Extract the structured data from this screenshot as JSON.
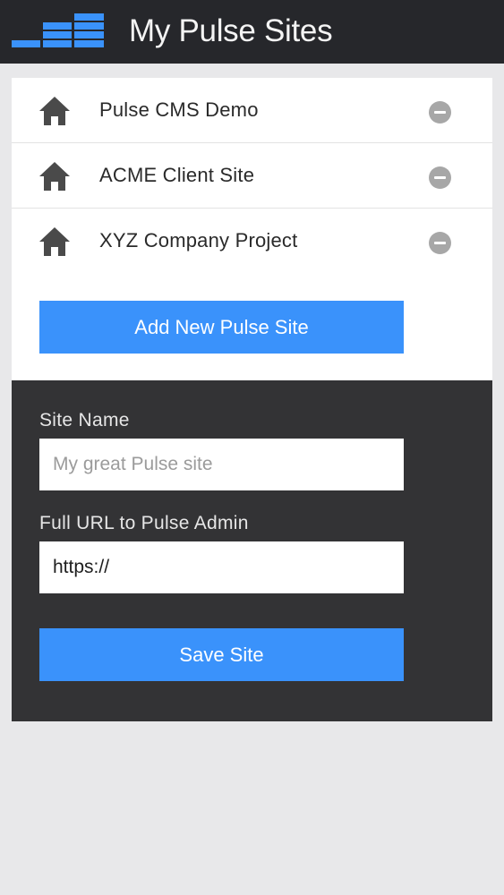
{
  "header": {
    "title": "My Pulse Sites",
    "logo_icon": "pulse-bars-logo-icon",
    "logo_color": "#3a92fb",
    "background": "#26272b"
  },
  "sites": [
    {
      "label": "Pulse CMS Demo",
      "icon": "home-icon",
      "action_icon": "remove-icon"
    },
    {
      "label": "ACME Client Site",
      "icon": "home-icon",
      "action_icon": "remove-icon"
    },
    {
      "label": "XYZ Company Project",
      "icon": "home-icon",
      "action_icon": "remove-icon"
    }
  ],
  "add_button": {
    "label": "Add New Pulse Site"
  },
  "form": {
    "site_name_label": "Site Name",
    "site_name_placeholder": "My great Pulse site",
    "site_name_value": "",
    "url_label": "Full URL to Pulse Admin",
    "url_value": "https://",
    "save_label": "Save Site"
  },
  "colors": {
    "accent": "#3a92fb",
    "panel": "#333335",
    "page_background": "#e8e8ea",
    "icon_gray": "#4a4a4a",
    "remove_gray": "#a7a7a7"
  }
}
